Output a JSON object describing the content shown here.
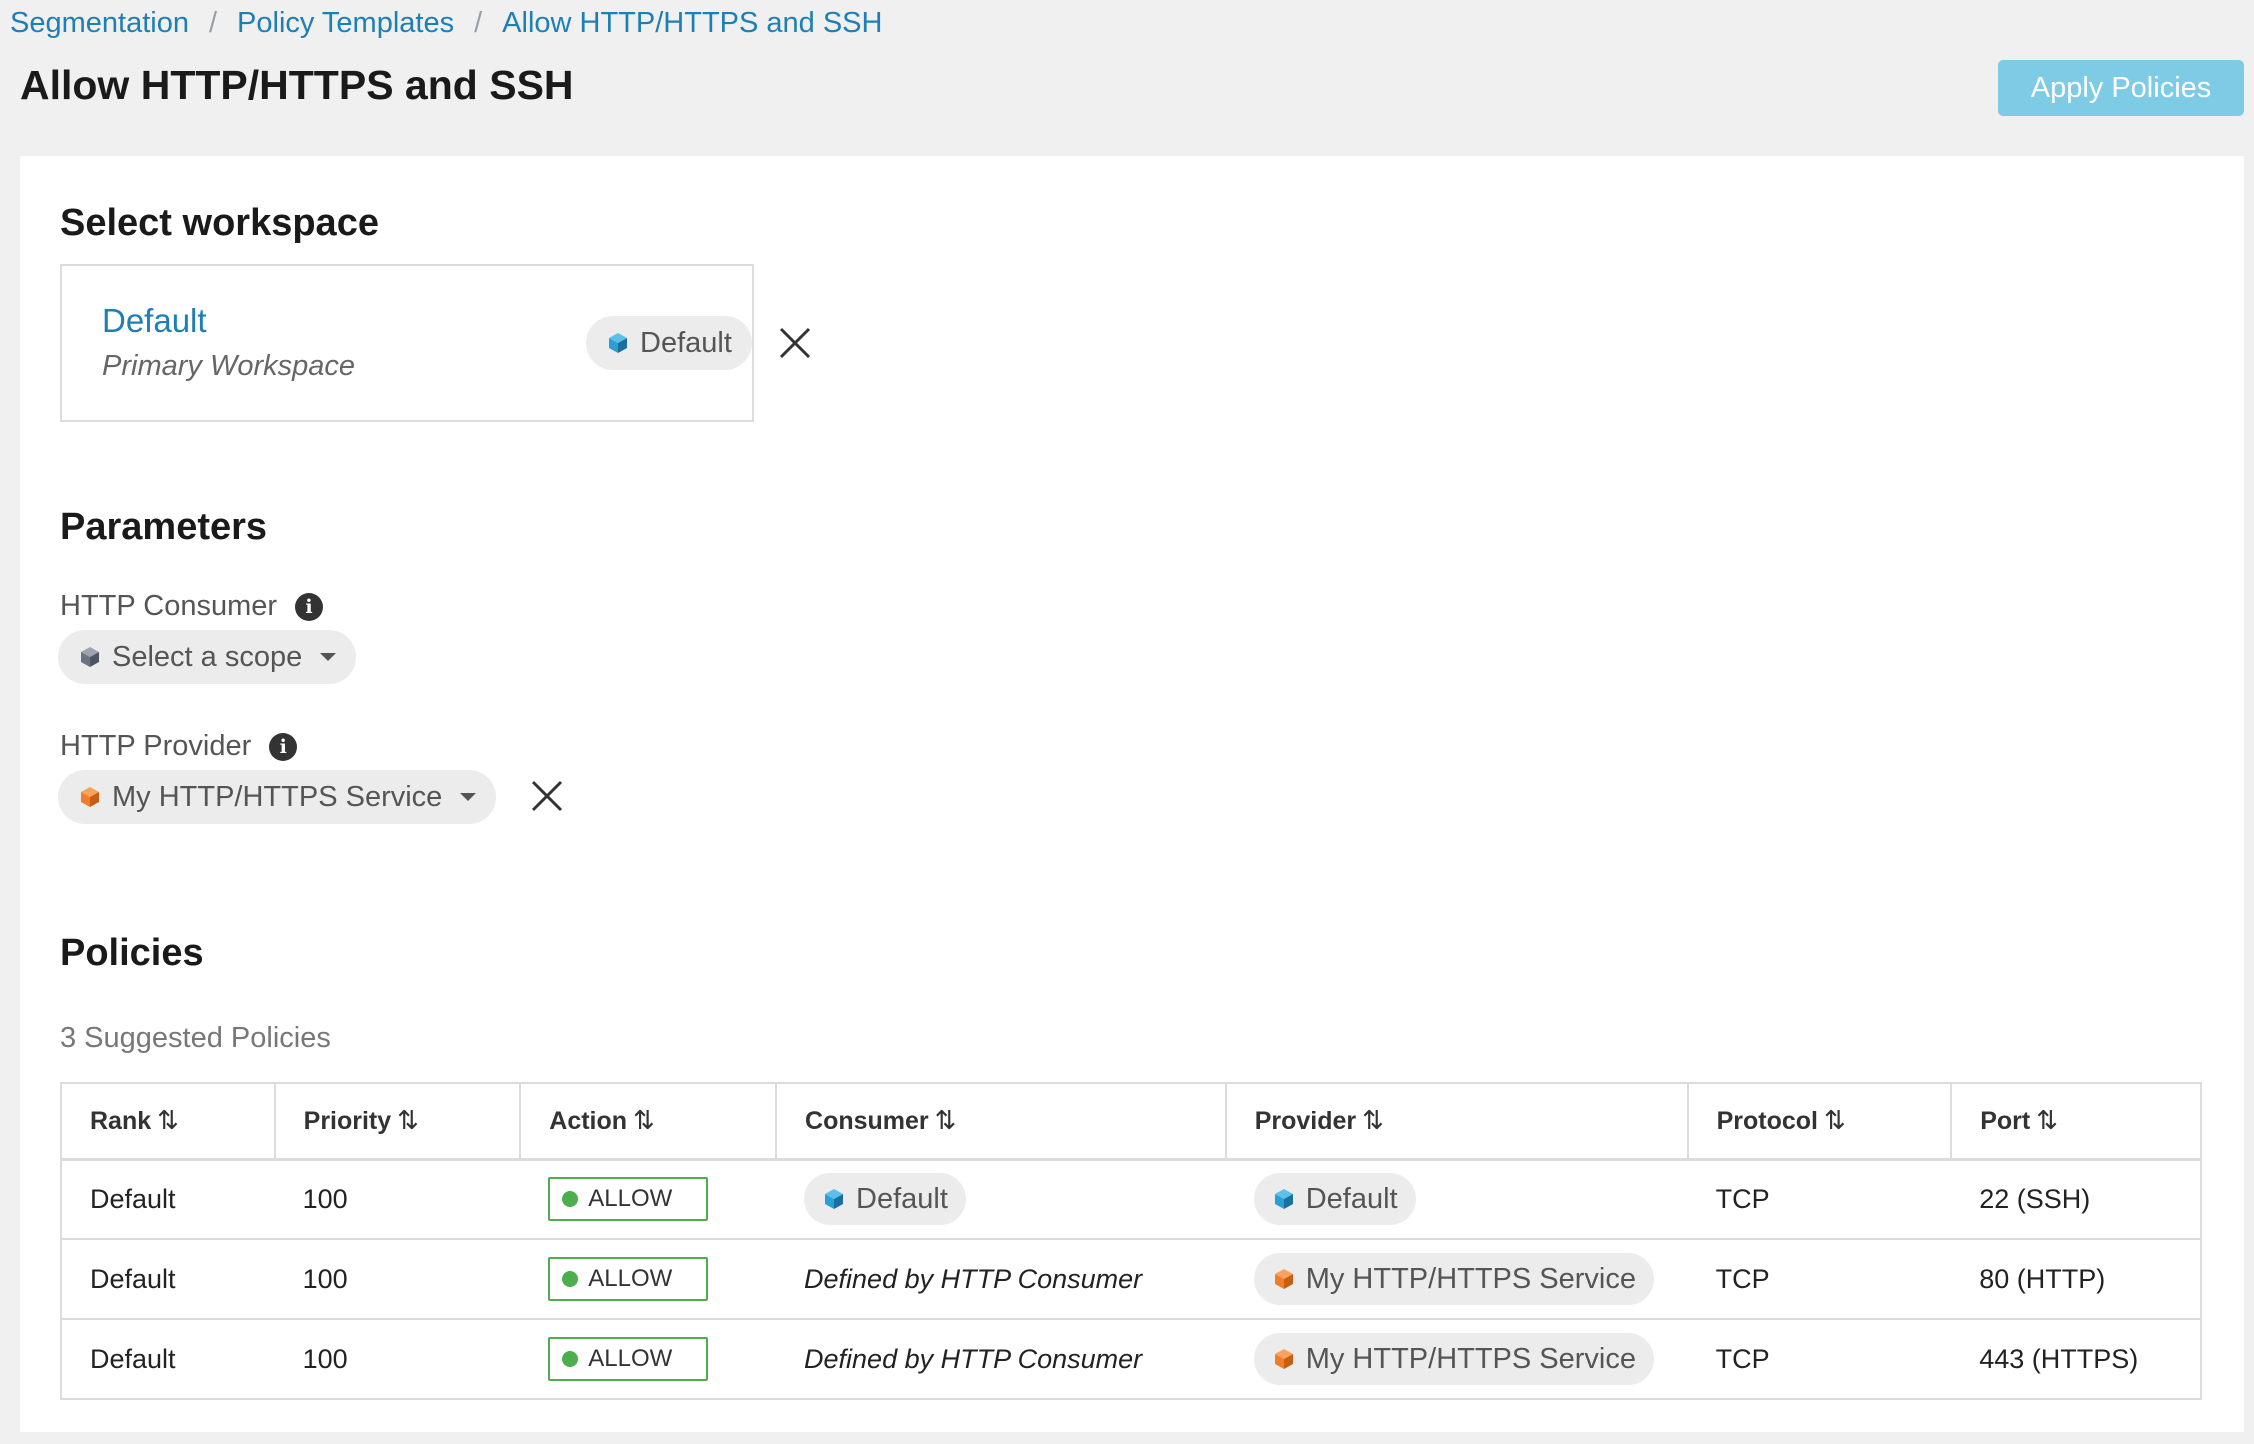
{
  "breadcrumb": [
    "Segmentation",
    "Policy Templates",
    "Allow HTTP/HTTPS and SSH"
  ],
  "page_title": "Allow HTTP/HTTPS and SSH",
  "apply_button": "Apply Policies",
  "workspace": {
    "section_title": "Select workspace",
    "name": "Default",
    "subtitle": "Primary Workspace",
    "scope_pill": "Default"
  },
  "parameters": {
    "section_title": "Parameters",
    "consumer_label": "HTTP Consumer",
    "consumer_value": "Select a scope",
    "provider_label": "HTTP Provider",
    "provider_value": "My HTTP/HTTPS Service"
  },
  "policies": {
    "section_title": "Policies",
    "suggested": "3 Suggested Policies",
    "columns": [
      "Rank",
      "Priority",
      "Action",
      "Consumer",
      "Provider",
      "Protocol",
      "Port"
    ],
    "rows": [
      {
        "rank": "Default",
        "priority": "100",
        "action": "ALLOW",
        "consumer": "Default",
        "consumer_type": "scope",
        "provider": "Default",
        "provider_type": "scope",
        "protocol": "TCP",
        "port": "22 (SSH)"
      },
      {
        "rank": "Default",
        "priority": "100",
        "action": "ALLOW",
        "consumer": "Defined by HTTP Consumer",
        "consumer_type": "text",
        "provider": "My HTTP/HTTPS Service",
        "provider_type": "service",
        "protocol": "TCP",
        "port": "80 (HTTP)"
      },
      {
        "rank": "Default",
        "priority": "100",
        "action": "ALLOW",
        "consumer": "Defined by HTTP Consumer",
        "consumer_type": "text",
        "provider": "My HTTP/HTTPS Service",
        "provider_type": "service",
        "protocol": "TCP",
        "port": "443 (HTTPS)"
      }
    ]
  },
  "icons": {
    "scope": "blue-cube-icon",
    "service": "orange-cube-icon",
    "unselected": "gray-cube-icon",
    "info": "info-icon",
    "close": "close-icon",
    "sort": "sort-icon",
    "dropdown": "chevron-down-icon"
  },
  "colors": {
    "link": "#1d7fb5",
    "primary_button": "#7ecbe6",
    "allow": "#4cae4c",
    "scope_cube": "#2a9fd6",
    "service_cube": "#f07d2c",
    "unselected_cube": "#6b7280"
  }
}
